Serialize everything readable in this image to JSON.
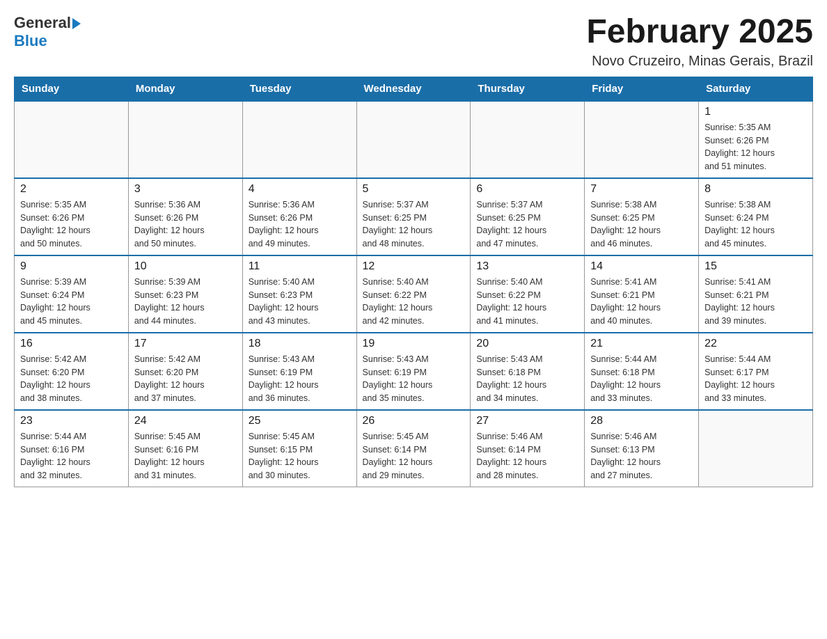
{
  "header": {
    "logo": {
      "general": "General",
      "blue": "Blue"
    },
    "title": "February 2025",
    "location": "Novo Cruzeiro, Minas Gerais, Brazil"
  },
  "weekdays": [
    "Sunday",
    "Monday",
    "Tuesday",
    "Wednesday",
    "Thursday",
    "Friday",
    "Saturday"
  ],
  "weeks": [
    [
      {
        "day": "",
        "info": ""
      },
      {
        "day": "",
        "info": ""
      },
      {
        "day": "",
        "info": ""
      },
      {
        "day": "",
        "info": ""
      },
      {
        "day": "",
        "info": ""
      },
      {
        "day": "",
        "info": ""
      },
      {
        "day": "1",
        "info": "Sunrise: 5:35 AM\nSunset: 6:26 PM\nDaylight: 12 hours\nand 51 minutes."
      }
    ],
    [
      {
        "day": "2",
        "info": "Sunrise: 5:35 AM\nSunset: 6:26 PM\nDaylight: 12 hours\nand 50 minutes."
      },
      {
        "day": "3",
        "info": "Sunrise: 5:36 AM\nSunset: 6:26 PM\nDaylight: 12 hours\nand 50 minutes."
      },
      {
        "day": "4",
        "info": "Sunrise: 5:36 AM\nSunset: 6:26 PM\nDaylight: 12 hours\nand 49 minutes."
      },
      {
        "day": "5",
        "info": "Sunrise: 5:37 AM\nSunset: 6:25 PM\nDaylight: 12 hours\nand 48 minutes."
      },
      {
        "day": "6",
        "info": "Sunrise: 5:37 AM\nSunset: 6:25 PM\nDaylight: 12 hours\nand 47 minutes."
      },
      {
        "day": "7",
        "info": "Sunrise: 5:38 AM\nSunset: 6:25 PM\nDaylight: 12 hours\nand 46 minutes."
      },
      {
        "day": "8",
        "info": "Sunrise: 5:38 AM\nSunset: 6:24 PM\nDaylight: 12 hours\nand 45 minutes."
      }
    ],
    [
      {
        "day": "9",
        "info": "Sunrise: 5:39 AM\nSunset: 6:24 PM\nDaylight: 12 hours\nand 45 minutes."
      },
      {
        "day": "10",
        "info": "Sunrise: 5:39 AM\nSunset: 6:23 PM\nDaylight: 12 hours\nand 44 minutes."
      },
      {
        "day": "11",
        "info": "Sunrise: 5:40 AM\nSunset: 6:23 PM\nDaylight: 12 hours\nand 43 minutes."
      },
      {
        "day": "12",
        "info": "Sunrise: 5:40 AM\nSunset: 6:22 PM\nDaylight: 12 hours\nand 42 minutes."
      },
      {
        "day": "13",
        "info": "Sunrise: 5:40 AM\nSunset: 6:22 PM\nDaylight: 12 hours\nand 41 minutes."
      },
      {
        "day": "14",
        "info": "Sunrise: 5:41 AM\nSunset: 6:21 PM\nDaylight: 12 hours\nand 40 minutes."
      },
      {
        "day": "15",
        "info": "Sunrise: 5:41 AM\nSunset: 6:21 PM\nDaylight: 12 hours\nand 39 minutes."
      }
    ],
    [
      {
        "day": "16",
        "info": "Sunrise: 5:42 AM\nSunset: 6:20 PM\nDaylight: 12 hours\nand 38 minutes."
      },
      {
        "day": "17",
        "info": "Sunrise: 5:42 AM\nSunset: 6:20 PM\nDaylight: 12 hours\nand 37 minutes."
      },
      {
        "day": "18",
        "info": "Sunrise: 5:43 AM\nSunset: 6:19 PM\nDaylight: 12 hours\nand 36 minutes."
      },
      {
        "day": "19",
        "info": "Sunrise: 5:43 AM\nSunset: 6:19 PM\nDaylight: 12 hours\nand 35 minutes."
      },
      {
        "day": "20",
        "info": "Sunrise: 5:43 AM\nSunset: 6:18 PM\nDaylight: 12 hours\nand 34 minutes."
      },
      {
        "day": "21",
        "info": "Sunrise: 5:44 AM\nSunset: 6:18 PM\nDaylight: 12 hours\nand 33 minutes."
      },
      {
        "day": "22",
        "info": "Sunrise: 5:44 AM\nSunset: 6:17 PM\nDaylight: 12 hours\nand 33 minutes."
      }
    ],
    [
      {
        "day": "23",
        "info": "Sunrise: 5:44 AM\nSunset: 6:16 PM\nDaylight: 12 hours\nand 32 minutes."
      },
      {
        "day": "24",
        "info": "Sunrise: 5:45 AM\nSunset: 6:16 PM\nDaylight: 12 hours\nand 31 minutes."
      },
      {
        "day": "25",
        "info": "Sunrise: 5:45 AM\nSunset: 6:15 PM\nDaylight: 12 hours\nand 30 minutes."
      },
      {
        "day": "26",
        "info": "Sunrise: 5:45 AM\nSunset: 6:14 PM\nDaylight: 12 hours\nand 29 minutes."
      },
      {
        "day": "27",
        "info": "Sunrise: 5:46 AM\nSunset: 6:14 PM\nDaylight: 12 hours\nand 28 minutes."
      },
      {
        "day": "28",
        "info": "Sunrise: 5:46 AM\nSunset: 6:13 PM\nDaylight: 12 hours\nand 27 minutes."
      },
      {
        "day": "",
        "info": ""
      }
    ]
  ]
}
